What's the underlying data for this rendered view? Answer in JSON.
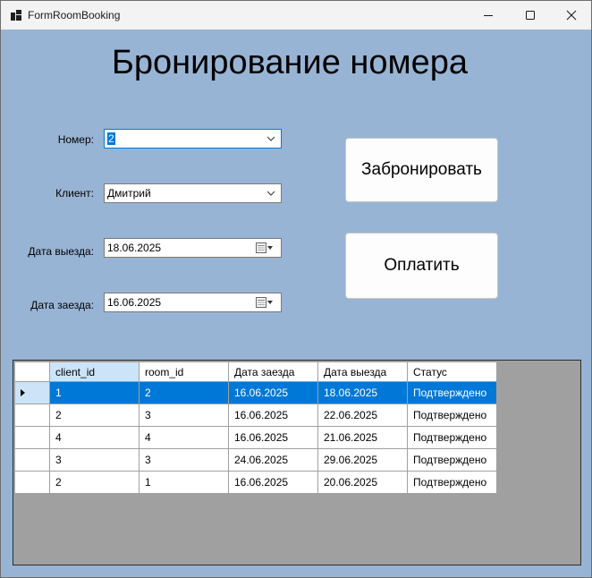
{
  "window": {
    "title": "FormRoomBooking",
    "controls": [
      "minimize",
      "maximize",
      "close"
    ]
  },
  "heading": "Бронирование номера",
  "form": {
    "room": {
      "label": "Номер:",
      "value": "2"
    },
    "client": {
      "label": "Клиент:",
      "value": "Дмитрий"
    },
    "checkout": {
      "label": "Дата выезда:",
      "value": "18.06.2025"
    },
    "checkin": {
      "label": "Дата заезда:",
      "value": "16.06.2025"
    }
  },
  "buttons": {
    "book": "Забронировать",
    "pay": "Оплатить"
  },
  "grid": {
    "columns": [
      "client_id",
      "room_id",
      "Дата заезда",
      "Дата выезда",
      "Статус"
    ],
    "rows": [
      [
        "1",
        "2",
        "16.06.2025",
        "18.06.2025",
        "Подтверждено"
      ],
      [
        "2",
        "3",
        "16.06.2025",
        "22.06.2025",
        "Подтверждено"
      ],
      [
        "4",
        "4",
        "16.06.2025",
        "21.06.2025",
        "Подтверждено"
      ],
      [
        "3",
        "3",
        "24.06.2025",
        "29.06.2025",
        "Подтверждено"
      ],
      [
        "2",
        "1",
        "16.06.2025",
        "20.06.2025",
        "Подтверждено"
      ]
    ],
    "selected_row": 0
  },
  "colors": {
    "form_background": "#98b4d4",
    "selection": "#0078d7",
    "grid_background": "#a0a0a0"
  }
}
